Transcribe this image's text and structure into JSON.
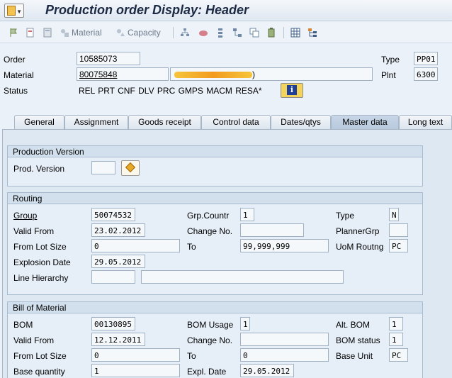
{
  "window": {
    "title": "Production order Display: Header"
  },
  "toolbar": {
    "material_label": "Material",
    "capacity_label": "Capacity"
  },
  "header": {
    "order_label": "Order",
    "order_value": "10585073",
    "type_label": "Type",
    "type_value": "PP01",
    "material_label": "Material",
    "material_value": "80075848",
    "material_desc_tail": ")",
    "plnt_label": "Plnt",
    "plnt_value": "6300",
    "status_label": "Status",
    "status_value": "REL  PRT  CNF  DLV  PRC  GMPS MACM RESA*"
  },
  "tabs": [
    "General",
    "Assignment",
    "Goods receipt",
    "Control data",
    "Dates/qtys",
    "Master data",
    "Long text"
  ],
  "active_tab": "Master data",
  "production_version": {
    "title": "Production Version",
    "prod_version_label": "Prod. Version",
    "prod_version_value": ""
  },
  "routing": {
    "title": "Routing",
    "group_label": "Group",
    "group_value": "50074532",
    "grp_countr_label": "Grp.Countr",
    "grp_countr_value": "1",
    "type_label": "Type",
    "type_value": "N",
    "valid_from_label": "Valid From",
    "valid_from_value": "23.02.2012",
    "change_no_label": "Change No.",
    "change_no_value": "",
    "planner_grp_label": "PlannerGrp",
    "planner_grp_value": "",
    "from_lot_size_label": "From Lot Size",
    "from_lot_size_value": "0",
    "to_label": "To",
    "to_value": "99,999,999",
    "uom_routng_label": "UoM Routng",
    "uom_routng_value": "PC",
    "explosion_date_label": "Explosion Date",
    "explosion_date_value": "29.05.2012",
    "line_hierarchy_label": "Line Hierarchy",
    "line_hierarchy_value": "",
    "line_hierarchy_desc": ""
  },
  "bom": {
    "title": "Bill of Material",
    "bom_label": "BOM",
    "bom_value": "00130895",
    "bom_usage_label": "BOM Usage",
    "bom_usage_value": "1",
    "alt_bom_label": "Alt. BOM",
    "alt_bom_value": "1",
    "valid_from_label": "Valid From",
    "valid_from_value": "12.12.2011",
    "change_no_label": "Change No.",
    "change_no_value": "",
    "bom_status_label": "BOM status",
    "bom_status_value": "1",
    "from_lot_size_label": "From Lot Size",
    "from_lot_size_value": "0",
    "to_label": "To",
    "to_value": "0",
    "base_unit_label": "Base Unit",
    "base_unit_value": "PC",
    "base_quantity_label": "Base quantity",
    "base_quantity_value": "1",
    "expl_date_label": "Expl. Date",
    "expl_date_value": "29.05.2012"
  }
}
